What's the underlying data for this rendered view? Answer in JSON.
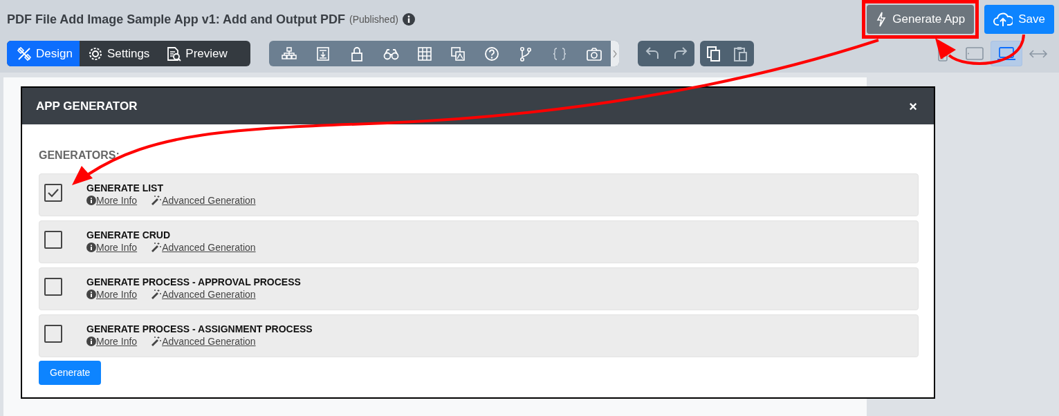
{
  "title": "PDF File Add Image Sample App v1: Add and Output PDF",
  "status": "(Published)",
  "header_buttons": [
    {
      "kind": "generate",
      "label": "Generate App",
      "highlighted": true
    },
    {
      "kind": "save",
      "label": "Save",
      "highlighted": false
    }
  ],
  "tabs": [
    {
      "kind": "design",
      "label": "Design",
      "selected": true
    },
    {
      "kind": "settings",
      "label": "Settings",
      "selected": false
    },
    {
      "kind": "preview",
      "label": "Preview",
      "selected": false
    }
  ],
  "view_modes": [
    {
      "kind": "phone",
      "selected": false
    },
    {
      "kind": "tablet",
      "selected": false
    },
    {
      "kind": "laptop",
      "selected": true
    },
    {
      "kind": "full-width",
      "selected": false
    }
  ],
  "modal": {
    "title": "APP GENERATOR",
    "close": "×",
    "section_label": "GENERATORS:",
    "generators": [
      {
        "name": "GENERATE LIST",
        "checked": true,
        "links": [
          "More Info",
          "Advanced Generation"
        ]
      },
      {
        "name": "GENERATE CRUD",
        "checked": false,
        "links": [
          "More Info",
          "Advanced Generation"
        ]
      },
      {
        "name": "GENERATE PROCESS - APPROVAL PROCESS",
        "checked": false,
        "links": [
          "More Info",
          "Advanced Generation"
        ]
      },
      {
        "name": "GENERATE PROCESS - ASSIGNMENT PROCESS",
        "checked": false,
        "links": [
          "More Info",
          "Advanced Generation"
        ]
      }
    ],
    "submit": "Generate"
  }
}
